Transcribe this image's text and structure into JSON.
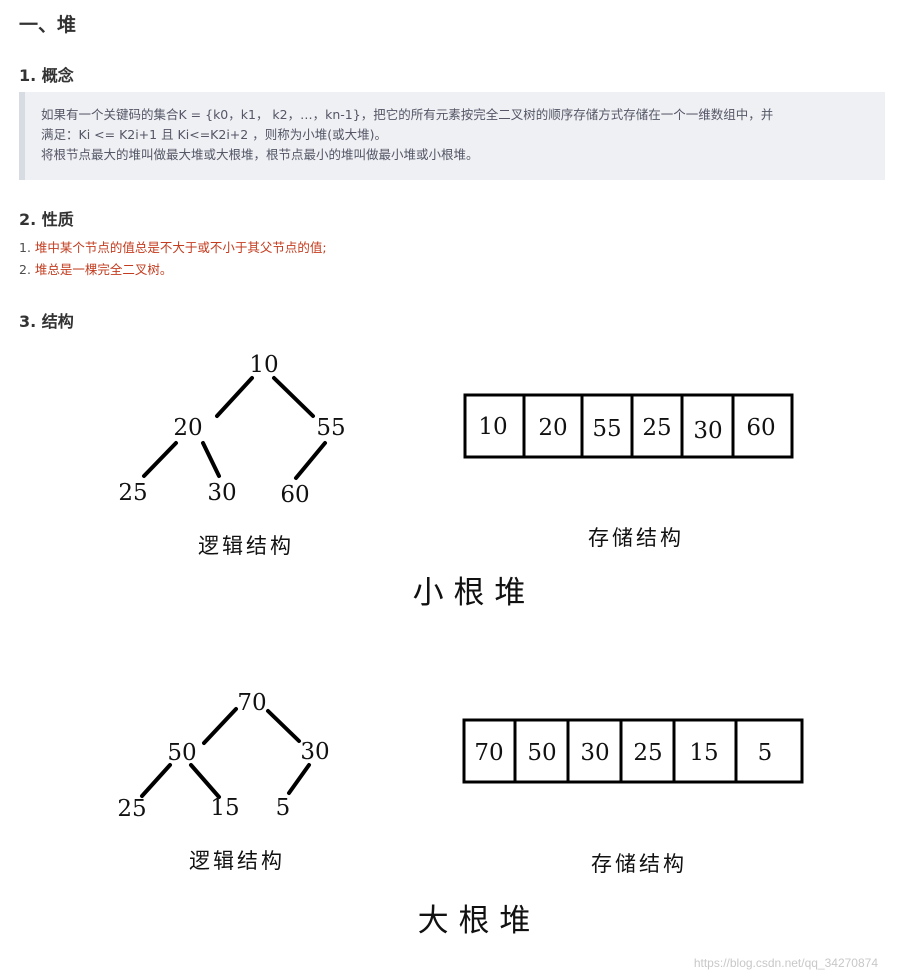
{
  "section_title": "一、堆",
  "concept": {
    "heading": "1. 概念",
    "lines": [
      "如果有一个关键码的集合K = {k0，k1， k2，…，kn-1}，把它的所有元素按完全二叉树的顺序存储方式存储在一个一维数组中，并",
      "满足：Ki <= K2i+1 且 Ki<=K2i+2 ，则称为小堆(或大堆)。",
      "将根节点最大的堆叫做最大堆或大根堆，根节点最小的堆叫做最小堆或小根堆。"
    ]
  },
  "properties": {
    "heading": "2. 性质",
    "items": [
      {
        "num": "1.",
        "text": "堆中某个节点的值总是不大于或不小于其父节点的值;"
      },
      {
        "num": "2.",
        "text": "堆总是一棵完全二叉树。"
      }
    ]
  },
  "structure": {
    "heading": "3. 结构",
    "min_heap": {
      "caption": "小 根 堆",
      "logical_label": "逻辑结构",
      "storage_label": "存储结构",
      "tree_nodes": [
        "10",
        "20",
        "55",
        "25",
        "30",
        "60"
      ],
      "array": [
        "10",
        "20",
        "55",
        "25",
        "30",
        "60"
      ]
    },
    "max_heap": {
      "caption": "大 根 堆",
      "logical_label": "逻辑结构",
      "storage_label": "存储结构",
      "tree_nodes": [
        "70",
        "50",
        "30",
        "25",
        "15",
        "5"
      ],
      "array": [
        "70",
        "50",
        "30",
        "25",
        "15",
        "5"
      ]
    }
  },
  "watermark": "https://blog.csdn.net/qq_34270874"
}
